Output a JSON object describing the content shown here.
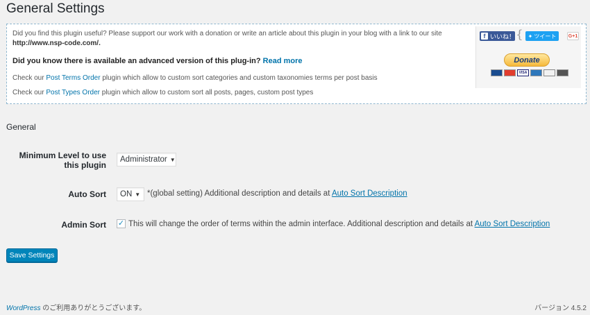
{
  "page": {
    "title": "General Settings"
  },
  "info_box": {
    "line1": "Did you find this plugin useful? Please support our work with a donation or write an article about this plugin in your blog with a link to our site",
    "line2": "http://www.nsp-code.com/.",
    "line3_text": "Did you know there is available an advanced version of this plug-in?",
    "line3_link": "Read more",
    "line4_pre": "Check our",
    "line4_link": "Post Terms Order",
    "line4_post": "plugin which allow to custom sort categories and custom taxonomies terms per post basis",
    "line5_pre": "Check our",
    "line5_link": "Post Types Order",
    "line5_post": "plugin which allow to custom sort all posts, pages, custom post types",
    "social": {
      "like_icon": "f",
      "like_label": "いいね！",
      "tweet_label": "ツイート",
      "gplus_label": "G+1"
    },
    "donate_label": "Donate",
    "card_icons": [
      "maestro-card-icon",
      "mastercard-icon",
      "visa-icon",
      "amex-icon",
      "discover-icon",
      "bank-icon"
    ]
  },
  "settings": {
    "section_title": "General",
    "min_level": {
      "label": "Minimum Level to use this plugin",
      "selected": "Administrator"
    },
    "auto_sort": {
      "label": "Auto Sort",
      "selected": "ON",
      "description": "*(global setting) Additional description and details at",
      "link": "Auto Sort Description"
    },
    "admin_sort": {
      "label": "Admin Sort",
      "checked": true,
      "description": "This will change the order of terms within the admin interface. Additional description and details at",
      "link": "Auto Sort Description"
    },
    "save_label": "Save Settings"
  },
  "footer": {
    "wordpress_link": "WordPress",
    "thanks_text": "のご利用ありがとうございます。",
    "version": "バージョン 4.5.2"
  },
  "colors": {
    "accent": "#0073aa",
    "button": "#0085ba",
    "background": "#f1f1f1"
  }
}
